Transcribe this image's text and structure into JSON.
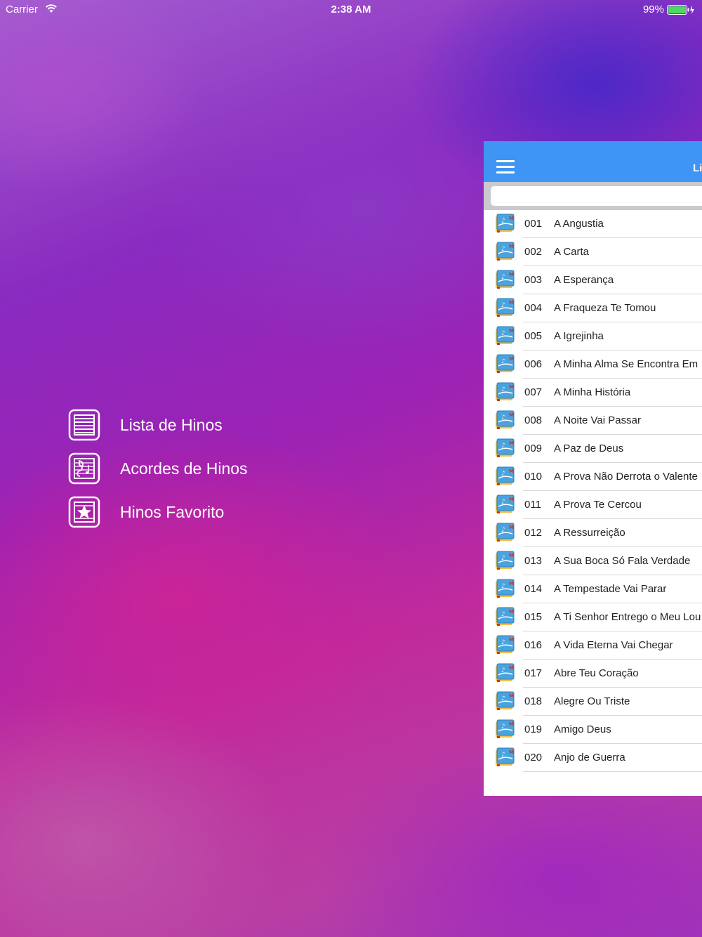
{
  "status_bar": {
    "carrier": "Carrier",
    "time": "2:38 AM",
    "battery": "99%"
  },
  "menu": {
    "items": [
      {
        "label": "Lista de Hinos",
        "icon": "list-icon"
      },
      {
        "label": "Acordes de Hinos",
        "icon": "sheet-music-icon"
      },
      {
        "label": "Hinos Favorito",
        "icon": "star-icon"
      }
    ]
  },
  "panel": {
    "title": "Li",
    "search": {
      "placeholder": "",
      "value": ""
    },
    "accent_color": "#3f95f3",
    "hymns": [
      {
        "number": "001",
        "title": "A Angustia"
      },
      {
        "number": "002",
        "title": "A Carta"
      },
      {
        "number": "003",
        "title": "A Esperança"
      },
      {
        "number": "004",
        "title": "A Fraqueza Te Tomou"
      },
      {
        "number": "005",
        "title": "A Igrejinha"
      },
      {
        "number": "006",
        "title": "A Minha Alma Se Encontra Em"
      },
      {
        "number": "007",
        "title": "A Minha História"
      },
      {
        "number": "008",
        "title": "A Noite Vai Passar"
      },
      {
        "number": "009",
        "title": "A Paz de Deus"
      },
      {
        "number": "010",
        "title": "A Prova Não Derrota o Valente"
      },
      {
        "number": "011",
        "title": "A Prova Te Cercou"
      },
      {
        "number": "012",
        "title": "A Ressurreição"
      },
      {
        "number": "013",
        "title": "A Sua Boca Só Fala Verdade"
      },
      {
        "number": "014",
        "title": "A Tempestade Vai Parar"
      },
      {
        "number": "015",
        "title": "A Ti Senhor Entrego o Meu Lou"
      },
      {
        "number": "016",
        "title": "A Vida Eterna Vai Chegar"
      },
      {
        "number": "017",
        "title": "Abre Teu Coração"
      },
      {
        "number": "018",
        "title": "Alegre Ou Triste"
      },
      {
        "number": "019",
        "title": "Amigo Deus"
      },
      {
        "number": "020",
        "title": "Anjo de Guerra"
      }
    ]
  }
}
